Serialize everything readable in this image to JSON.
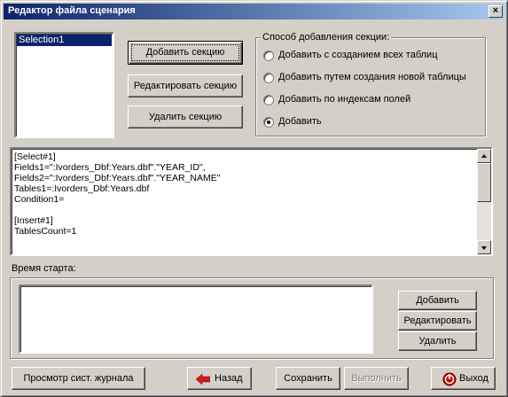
{
  "window": {
    "title": "Редактор файла сценария",
    "controls": {
      "close": "×"
    }
  },
  "sections": {
    "items": [
      "Selection1"
    ],
    "selected_index": 0,
    "add_label": "Добавить секцию",
    "edit_label": "Редактировать секцию",
    "delete_label": "Удалить секцию"
  },
  "add_method": {
    "title": "Способ добавления секции:",
    "options": [
      "Добавить с созданием всех таблиц",
      "Добавить путем создания новой таблицы",
      "Добавить по индексам полей",
      "Добавить"
    ],
    "selected": "Добавить"
  },
  "script_text": [
    "[Select#1]",
    "Fields1=\":Ivorders_Dbf:Years.dbf\".\"YEAR_ID\",",
    "Fields2=\":Ivorders_Dbf:Years.dbf\".\"YEAR_NAME\"",
    "Tables1=:Ivorders_Dbf:Years.dbf",
    "Condition1=",
    "",
    "[Insert#1]",
    "TablesCount=1"
  ],
  "start_time": {
    "label": "Время старта:",
    "add_label": "Добавить",
    "edit_label": "Редактировать",
    "delete_label": "Удалить"
  },
  "footer": {
    "log_label": "Просмотр сист. журнала",
    "back_label": "Назад",
    "save_label": "Сохранить",
    "run_label": "Выполнить",
    "exit_label": "Выход"
  },
  "colors": {
    "title_start": "#0a246a",
    "title_end": "#a6caf0",
    "selection": "#0a246a",
    "back_arrow": "#d11a1a",
    "exit_icon": "#cc0000"
  }
}
